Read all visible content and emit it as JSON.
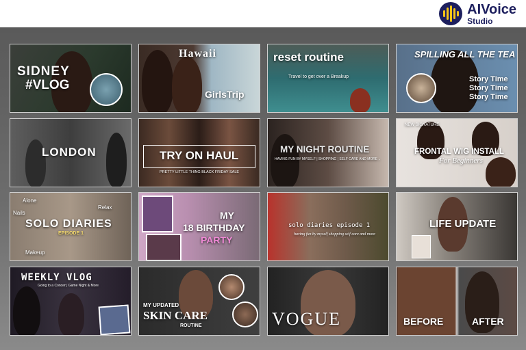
{
  "brand": {
    "name": "AIVoice",
    "sub": "Studio",
    "color": "#1d1f5e",
    "accent": "#f5c518"
  },
  "tiles": [
    {
      "title": "SIDNEY",
      "subtitle": "#VLOG"
    },
    {
      "title": "Hawaii",
      "subtitle": "GirlsTrip"
    },
    {
      "title": "reset routine",
      "subtitle": "Travel to get over a Breakup"
    },
    {
      "title": "SPILLING ALL THE TEA",
      "lines": [
        "Story Time",
        "Story Time",
        "Story Time"
      ]
    },
    {
      "title": "LONDON"
    },
    {
      "title": "TRY ON HAUL",
      "subtitle": "PRETTY LITTLE THING BLACK FRIDAY SALE"
    },
    {
      "title": "MY NIGHT ROUTINE",
      "subtitle": "HAVING FUN BY MYSELF | SHOPPING | SELF CARE AND MORE .."
    },
    {
      "title": "FRONTAL WIG INSTALL",
      "kicker": "NEW SIGNATURE",
      "subtitle": "For Beginners"
    },
    {
      "title": "SOLO DIARIES",
      "subtitle": "EPISODE 1",
      "tags": [
        "Alone",
        "Nails",
        "Relax",
        "Makeup"
      ]
    },
    {
      "title_a": "MY",
      "title_b": "18 BIRTHDAY",
      "title_c": "PARTY"
    },
    {
      "title": "solo diaries episode 1",
      "subtitle": "having fun by myself shopping self care and more"
    },
    {
      "title": "LIFE UPDATE"
    },
    {
      "title": "WEEKLY VLOG",
      "subtitle": "Going to a Concert, Game Night & More"
    },
    {
      "kicker": "MY UPDATED",
      "title": "SKIN CARE",
      "subtitle": "ROUTINE"
    },
    {
      "title": "VOGUE"
    },
    {
      "left": "BEFORE",
      "right": "AFTER"
    }
  ]
}
